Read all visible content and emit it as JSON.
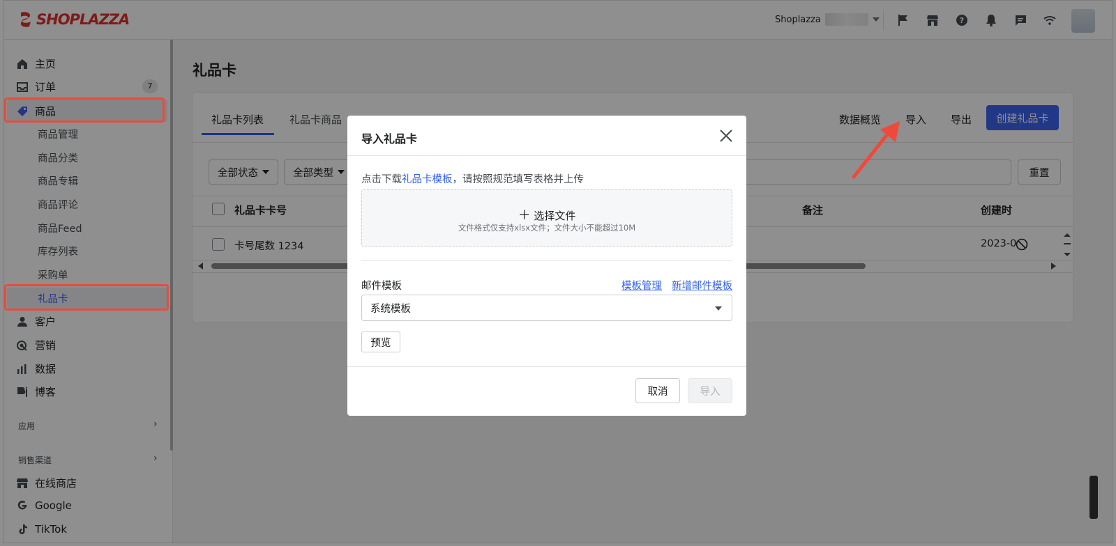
{
  "brand": {
    "logo_text": "SHOPLAZZA",
    "accent": "#e0302a"
  },
  "topbar": {
    "store_name": "Shoplazza",
    "icons": [
      "flag-icon",
      "store-icon",
      "help-icon",
      "bell-icon",
      "chat-icon",
      "wifi-icon"
    ]
  },
  "sidebar": {
    "home": "主页",
    "orders": "订单",
    "orders_count": "7",
    "products": "商品",
    "product_sub": [
      "商品管理",
      "商品分类",
      "商品专辑",
      "商品评论",
      "商品Feed",
      "库存列表",
      "采购单",
      "礼品卡"
    ],
    "customers": "客户",
    "marketing": "营销",
    "analytics": "数据",
    "blog": "博客",
    "apps_section": "应用",
    "channels_section": "销售渠道",
    "online_store": "在线商店",
    "google": "Google",
    "tiktok": "TikTok"
  },
  "page": {
    "title": "礼品卡",
    "tabs": [
      "礼品卡列表",
      "礼品卡商品"
    ],
    "actions": {
      "overview": "数据概览",
      "import": "导入",
      "export": "导出",
      "create": "创建礼品卡"
    },
    "filters": {
      "status": "全部状态",
      "type": "全部类型",
      "reset": "重置"
    },
    "table": {
      "headers": {
        "card_no": "礼品卡卡号",
        "note": "备注",
        "created": "创建时"
      },
      "rows": [
        {
          "card_no": "卡号尾数 1234",
          "created": "2023-0"
        }
      ]
    }
  },
  "modal": {
    "title": "导入礼品卡",
    "hint_prefix": "点击下载",
    "hint_link": "礼品卡模板",
    "hint_suffix": "，请按照规范填写表格并上传",
    "choose_file": "选择文件",
    "file_rule": "文件格式仅支持xlsx文件；文件大小不能超过10M",
    "email_template_label": "邮件模板",
    "manage_templates": "模板管理",
    "new_template": "新增邮件模板",
    "selected_template": "系统模板",
    "preview": "预览",
    "cancel": "取消",
    "import": "导入"
  },
  "colors": {
    "primary": "#3d64ef",
    "link": "#2f5ff0",
    "highlight": "#e74c3c"
  }
}
